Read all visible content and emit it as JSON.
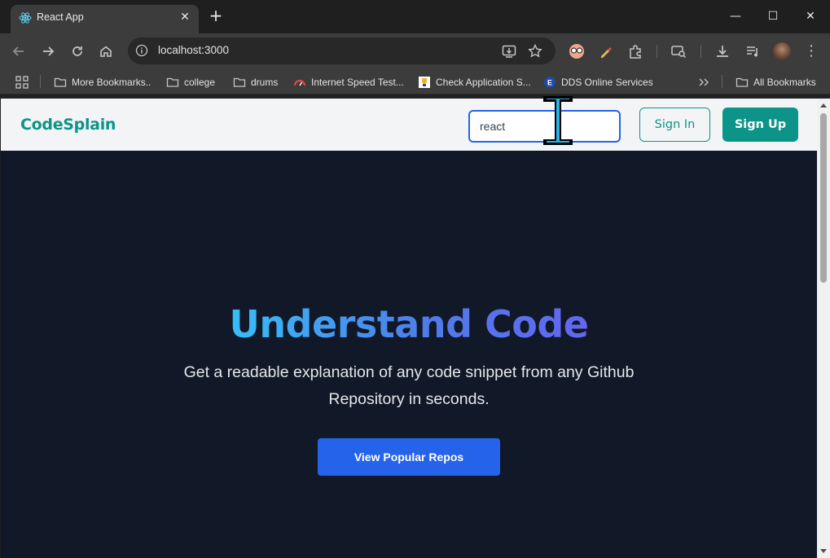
{
  "browser": {
    "tab": {
      "title": "React App"
    },
    "address": {
      "url": "localhost:3000"
    },
    "bookmarks": [
      {
        "label": "More Bookmarks..",
        "icon": "folder-icon"
      },
      {
        "label": "college",
        "icon": "folder-icon"
      },
      {
        "label": "drums",
        "icon": "folder-icon"
      },
      {
        "label": "Internet Speed Test...",
        "icon": "speedometer-icon"
      },
      {
        "label": "Check Application S...",
        "icon": "trophy-icon"
      },
      {
        "label": "DDS Online Services",
        "icon": "circle-e-icon"
      },
      {
        "label": "All Bookmarks",
        "icon": "folder-icon"
      }
    ],
    "colors": {
      "chrome_dark": "#1f1f1f",
      "toolbar": "#3c3c3c"
    }
  },
  "site": {
    "brand": "CodeSplain",
    "search": {
      "value": "react",
      "placeholder": ""
    },
    "signin_label": "Sign In",
    "signup_label": "Sign Up",
    "hero": {
      "title": "Understand Code",
      "subtitle": "Get a readable explanation of any code snippet from any Github Repository in seconds.",
      "cta_label": "View Popular Repos"
    },
    "colors": {
      "teal": "#0d9488",
      "blue": "#2563eb",
      "background": "#111827"
    }
  }
}
